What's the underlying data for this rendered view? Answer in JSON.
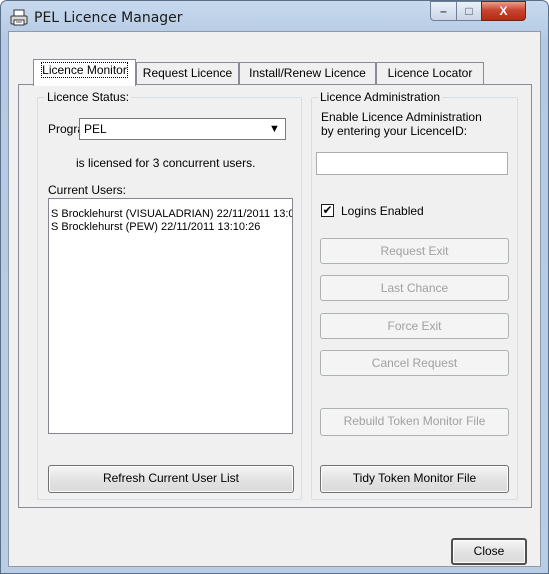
{
  "window": {
    "title": "PEL Licence Manager",
    "icon": "printer-icon",
    "controls": {
      "minimize": "–",
      "maximize": "□",
      "close": "X"
    }
  },
  "tabs": [
    {
      "label": "Licence Monitor",
      "active": true
    },
    {
      "label": "Request Licence",
      "active": false
    },
    {
      "label": "Install/Renew Licence",
      "active": false
    },
    {
      "label": "Licence Locator",
      "active": false
    }
  ],
  "licence_status": {
    "legend": "Licence Status:",
    "program_label": "Program",
    "program_value": "PEL",
    "licensed_text": "is licensed for 3 concurrent users.",
    "current_users_label": "Current Users:",
    "users": [
      "S Brocklehurst (VISUALADRIAN) 22/11/2011 13:0",
      "S Brocklehurst (PEW) 22/11/2011 13:10:26"
    ],
    "refresh_button": "Refresh Current User List"
  },
  "licence_admin": {
    "legend": "Licence Administration",
    "enable_line1": "Enable Licence Administration",
    "enable_line2": "by entering your LicenceID:",
    "licence_id_value": "",
    "logins_enabled_label": "Logins Enabled",
    "logins_enabled_checked": true,
    "buttons": {
      "request_exit": "Request Exit",
      "last_chance": "Last Chance",
      "force_exit": "Force Exit",
      "cancel_request": "Cancel Request",
      "rebuild_token": "Rebuild Token Monitor File",
      "tidy_token": "Tidy Token Monitor File"
    }
  },
  "footer": {
    "close_button": "Close"
  },
  "colors": {
    "title_bar": "#b9cde5",
    "close_button": "#c84630",
    "panel": "#f0f0f0",
    "disabled_text": "#a0a0a0"
  }
}
